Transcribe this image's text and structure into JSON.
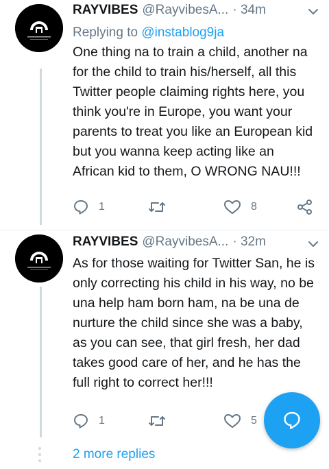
{
  "tweets": [
    {
      "name": "RAYVIBES",
      "handle": "@RayvibesA...",
      "time": "· 34m",
      "replying_prefix": "Replying to ",
      "replying_to": "@instablog9ja",
      "text": "One thing na to train a child, another na for the child to train his/herself, all this Twitter people claiming rights here, you think you're in Europe, you want your parents to treat you like an European kid but you wanna keep acting like an African kid to them, O WRONG NAU!!!",
      "replies": "1",
      "retweets": "",
      "likes": "8"
    },
    {
      "name": "RAYVIBES",
      "handle": "@RayvibesA...",
      "time": "· 32m",
      "text": "As for those waiting for Twitter San, he is only correcting his child in his way, no be una help ham born ham, na be una de nurture the child since she was a baby, as you can see, that girl fresh, her dad takes good care of her, and he has the full right to correct her!!!",
      "replies": "1",
      "retweets": "",
      "likes": "5"
    }
  ],
  "more_replies": "2 more replies",
  "icons": {
    "reply": "reply-icon",
    "retweet": "retweet-icon",
    "like": "heart-icon",
    "share": "share-icon",
    "caret": "chevron-down-icon",
    "compose": "compose-reply-icon"
  },
  "colors": {
    "accent": "#1da1f2",
    "secondary_text": "#657786",
    "thread_line": "#cfd9de"
  }
}
